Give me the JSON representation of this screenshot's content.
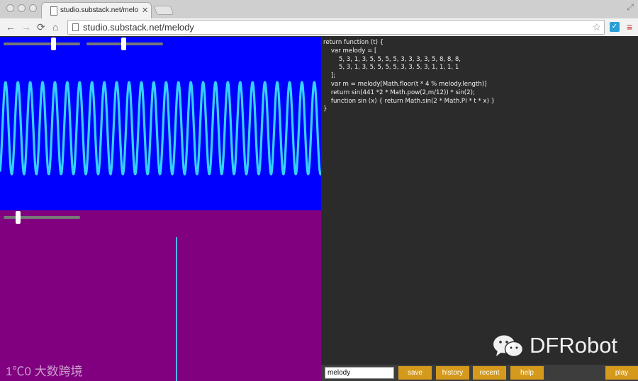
{
  "browser": {
    "tab_title": "studio.substack.net/melo",
    "tab_close": "✕",
    "url": "studio.substack.net/melody",
    "nav": {
      "back": "←",
      "forward": "→",
      "reload": "⟳",
      "home": "⌂"
    },
    "star": "☆",
    "extension_glyph": "✓",
    "menu_glyph": "≡",
    "resize_glyph": "⤢"
  },
  "colors": {
    "wave_background": "#0000ff",
    "wave_line": "#35d0ff",
    "spectrum_background": "#800080",
    "spectrum_line": "#4fb8e8",
    "editor_background": "#2b2b2b",
    "button": "#d59a1c"
  },
  "visualizer": {
    "wave_cycles": 26,
    "slider_levels": {
      "wave_a": 0.66,
      "wave_b": 0.49,
      "spectrum": 0.17
    }
  },
  "code": {
    "lines": [
      "return function (t) {",
      "    var melody = [",
      "        5, 3, 1, 3, 5, 5, 5, 5, 3, 3, 3, 3, 5, 8, 8, 8,",
      "        5, 3, 1, 3, 5, 5, 5, 5, 3, 3, 5, 3, 1, 1, 1, 1",
      "    ];",
      "    var m = melody[Math.floor(t * 4 % melody.length)]",
      "    return sin(441 *2 * Math.pow(2,m/12)) * sin(2);",
      "    function sin (x) { return Math.sin(2 * Math.PI * t * x) }",
      "}"
    ]
  },
  "controls": {
    "name_value": "melody",
    "save": "save",
    "history": "history",
    "recent": "recent",
    "help": "help",
    "play": "play"
  },
  "watermarks": {
    "left": "1℃0 大数跨境",
    "right": "DFRobot"
  }
}
